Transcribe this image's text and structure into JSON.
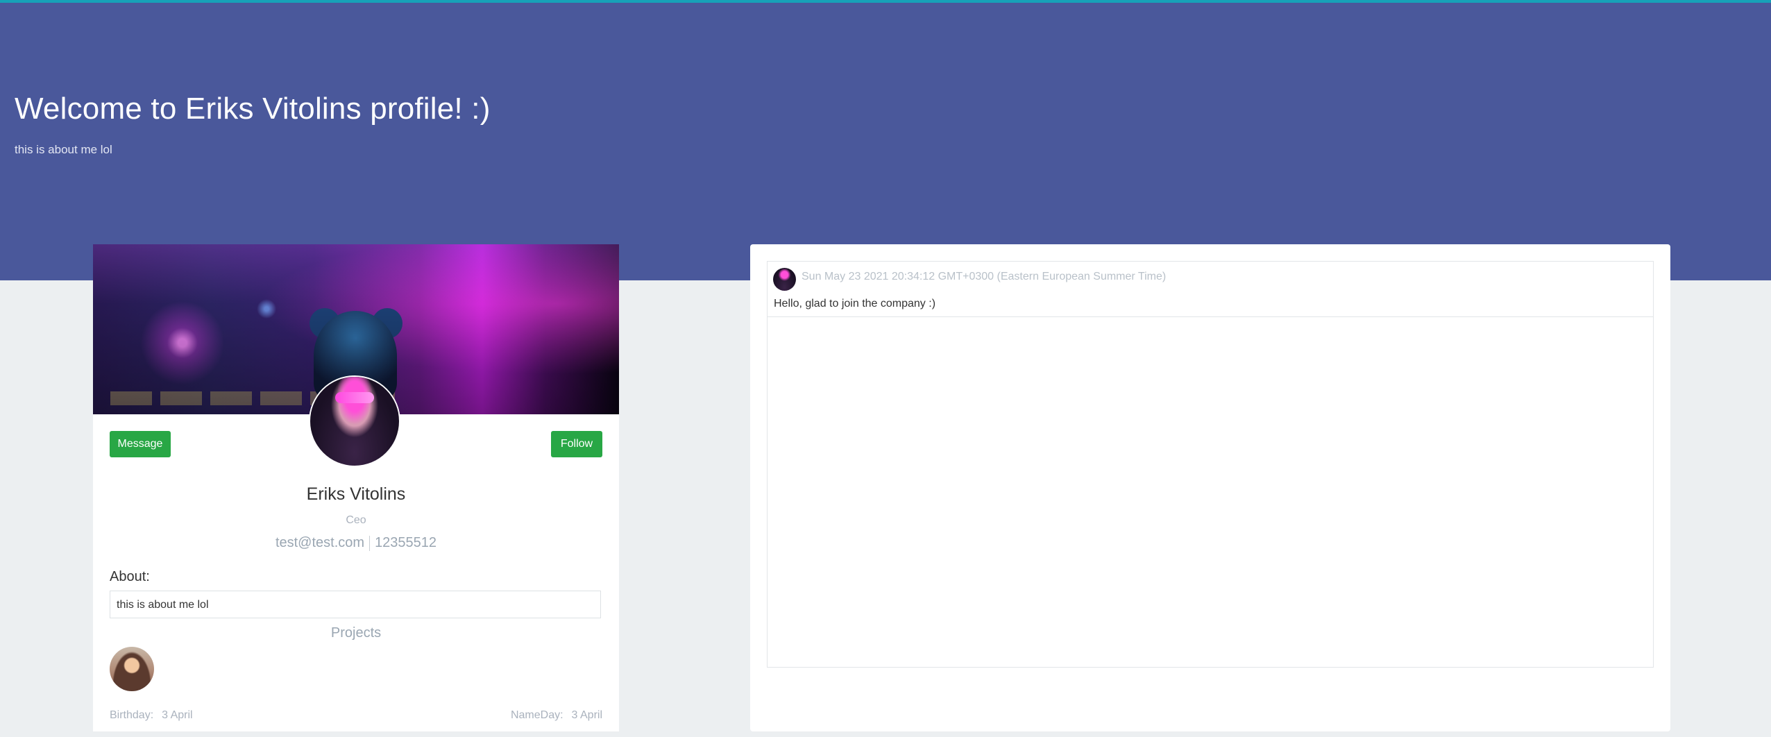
{
  "hero": {
    "title": "Welcome to Eriks Vitolins profile! :)",
    "subtitle": "this is about me lol"
  },
  "profile": {
    "message_button": "Message",
    "follow_button": "Follow",
    "name": "Eriks Vitolins",
    "role": "Ceo",
    "email": "test@test.com",
    "phone": "12355512",
    "about_label": "About:",
    "about_text": "this is about me lol",
    "projects_label": "Projects",
    "birthday_label": "Birthday:",
    "birthday_value": "3 April",
    "nameday_label": "NameDay:",
    "nameday_value": "3 April"
  },
  "feed": {
    "posts": [
      {
        "date": "Sun May 23 2021 20:34:12 GMT+0300 (Eastern European Summer Time)",
        "text": "Hello, glad to join the company :)"
      }
    ]
  },
  "colors": {
    "hero_bg": "#4a589b",
    "top_accent": "#17a2b8",
    "button_green": "#28a745",
    "page_bg": "#eceff1"
  },
  "icons": {
    "avatar": "user-avatar-image",
    "cover": "cover-image",
    "project": "project-thumbnail-image"
  }
}
